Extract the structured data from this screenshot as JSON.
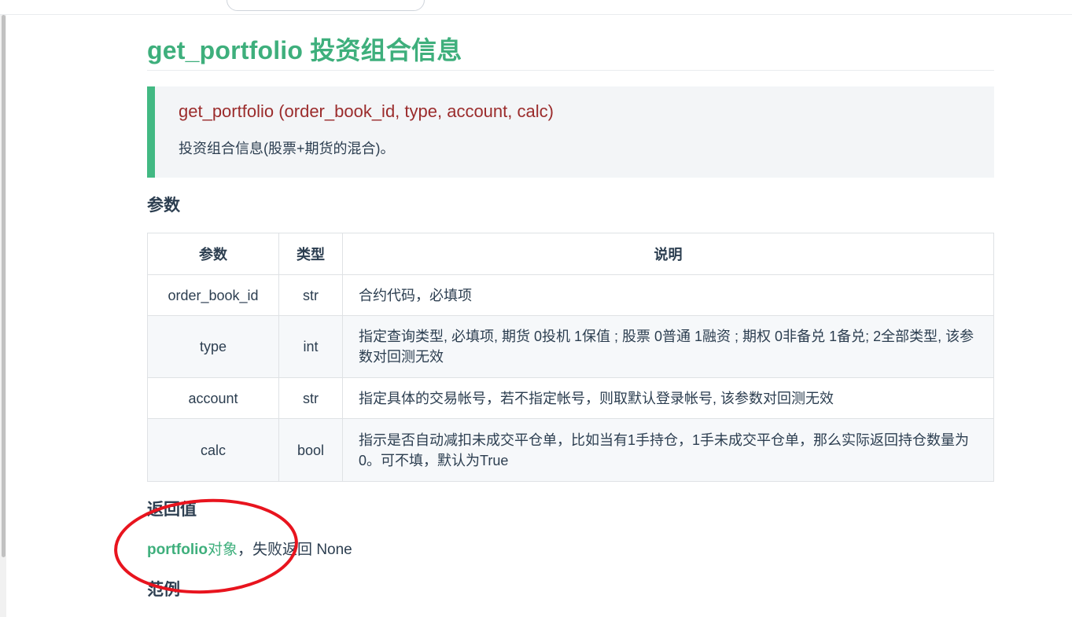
{
  "page_title": "get_portfolio 投资组合信息",
  "signature": "get_portfolio (order_book_id, type, account, calc)",
  "description": "投资组合信息(股票+期货的混合)。",
  "params_heading": "参数",
  "table": {
    "headers": [
      "参数",
      "类型",
      "说明"
    ],
    "rows": [
      {
        "name": "order_book_id",
        "type": "str",
        "desc": "合约代码，必填项"
      },
      {
        "name": "type",
        "type": "int",
        "desc": "指定查询类型, 必填项, 期货 0投机 1保值 ; 股票 0普通 1融资 ; 期权 0非备兑 1备兑; 2全部类型, 该参数对回测无效"
      },
      {
        "name": "account",
        "type": "str",
        "desc": "指定具体的交易帐号，若不指定帐号，则取默认登录帐号, 该参数对回测无效"
      },
      {
        "name": "calc",
        "type": "bool",
        "desc": "指示是否自动减扣未成交平仓单，比如当有1手持仓，1手未成交平仓单，那么实际返回持仓数量为0。可不填，默认为True"
      }
    ]
  },
  "return_heading": "返回值",
  "return_value": {
    "link_latin": "portfolio",
    "link_cn": "对象",
    "rest": "，失败返回 None"
  },
  "example_heading": "范例",
  "colors": {
    "accent": "#3eaf7c",
    "signature": "#9b2c2c",
    "annotation": "#e8141e"
  }
}
